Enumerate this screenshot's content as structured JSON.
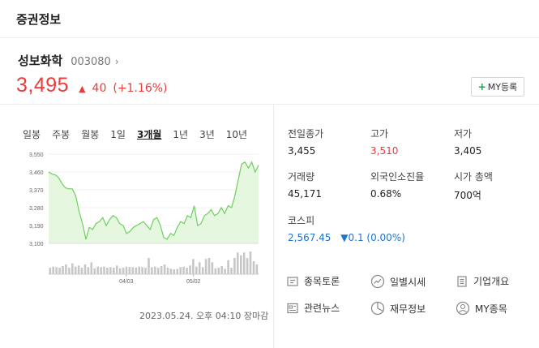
{
  "header": {
    "title": "증권정보"
  },
  "stock": {
    "name": "성보화학",
    "code": "003080",
    "price": "3,495",
    "change": "40",
    "change_rate": "(+1.16%)",
    "direction": "up",
    "my_button_label": "MY등록"
  },
  "periods": [
    "일봉",
    "주봉",
    "월봉",
    "1일",
    "3개월",
    "1년",
    "3년",
    "10년"
  ],
  "active_period": "3개월",
  "chart_data": {
    "type": "area",
    "ylim": [
      3100,
      3550
    ],
    "y_ticks": [
      "3,550",
      "3,460",
      "3,370",
      "3,280",
      "3,190",
      "3,100"
    ],
    "x_ticks": [
      "04/03",
      "05/02"
    ],
    "price_values": [
      3460,
      3450,
      3445,
      3430,
      3400,
      3380,
      3375,
      3375,
      3340,
      3260,
      3200,
      3120,
      3180,
      3170,
      3200,
      3210,
      3230,
      3190,
      3220,
      3240,
      3230,
      3200,
      3190,
      3150,
      3160,
      3180,
      3190,
      3200,
      3210,
      3190,
      3170,
      3220,
      3230,
      3190,
      3130,
      3120,
      3150,
      3140,
      3180,
      3210,
      3200,
      3240,
      3230,
      3290,
      3190,
      3200,
      3240,
      3250,
      3270,
      3240,
      3250,
      3280,
      3250,
      3290,
      3280,
      3340,
      3420,
      3500,
      3510,
      3480,
      3510,
      3460,
      3495
    ],
    "volume_values": [
      12,
      14,
      13,
      12,
      15,
      18,
      12,
      20,
      14,
      16,
      12,
      18,
      13,
      22,
      11,
      14,
      13,
      14,
      12,
      13,
      12,
      16,
      11,
      12,
      14,
      13,
      13,
      12,
      14,
      13,
      12,
      30,
      13,
      14,
      12,
      15,
      18,
      12,
      10,
      9,
      10,
      13,
      14,
      12,
      16,
      28,
      14,
      22,
      13,
      28,
      30,
      22,
      11,
      12,
      15,
      10,
      26,
      12,
      30,
      40,
      35,
      40,
      30,
      42,
      24,
      18
    ],
    "line_color": "#6fcf5e",
    "fill_color": "#e6f7df"
  },
  "timestamp": "2023.05.24. 오후 04:10 장마감",
  "stats": {
    "prev_close_label": "전일종가",
    "prev_close": "3,455",
    "high_label": "고가",
    "high": "3,510",
    "low_label": "저가",
    "low": "3,405",
    "volume_label": "거래량",
    "volume": "45,171",
    "foreign_label": "외국인소진율",
    "foreign": "0.68%",
    "mcap_label": "시가 총액",
    "mcap": "700억",
    "index_label": "코스피",
    "index_value": "2,567.45",
    "index_change": "▼0.1 (0.00%)"
  },
  "links": {
    "forum": "종목토론",
    "daily": "일별시세",
    "company": "기업개요",
    "news": "관련뉴스",
    "finance": "재무정보",
    "mystock": "MY종목"
  },
  "colors": {
    "up": "#ea3c3c",
    "down": "#1e74d1",
    "accent": "#1fa246"
  }
}
